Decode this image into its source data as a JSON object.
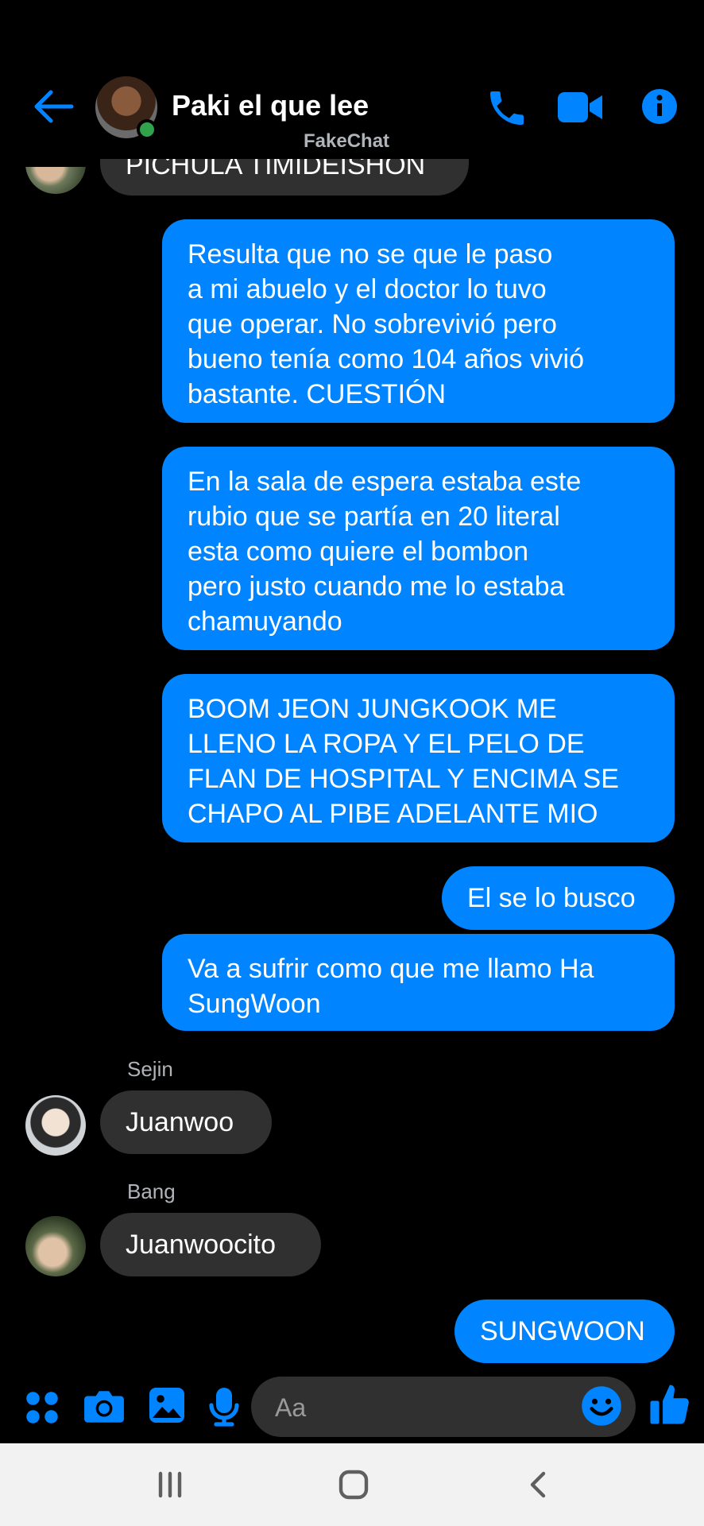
{
  "header": {
    "contact_name": "Paki el que lee",
    "watermark": "FakeChat",
    "icons": [
      "back-arrow-icon",
      "phone-icon",
      "video-camera-icon",
      "info-icon"
    ]
  },
  "messages": {
    "partial_in": "PICHULA TIMIDEISHON",
    "out_1": "Resulta que no se que le paso\na mi abuelo y el doctor lo tuvo\nque operar. No sobrevivió pero\nbueno tenía como 104 años vivió\nbastante. CUESTIÓN",
    "out_2": "En la sala de espera estaba este\nrubio que se partía en 20 literal\nesta como quiere el bombon\npero justo cuando me lo estaba\nchamuyando",
    "out_3": "BOOM JEON JUNGKOOK ME\nLLENO LA ROPA Y EL PELO DE\nFLAN DE HOSPITAL Y ENCIMA SE\nCHAPO AL PIBE ADELANTE MIO",
    "out_4": "El se lo busco",
    "out_5": "Va a sufrir como que me llamo Ha\nSungWoon",
    "sender_1": "Sejin",
    "in_1": "Juanwoo",
    "sender_2": "Bang",
    "in_2": "Juanwoocito",
    "out_6": "SUNGWOON"
  },
  "composer": {
    "placeholder": "Aa",
    "icons": [
      "apps-icon",
      "camera-icon",
      "gallery-icon",
      "microphone-icon",
      "emoji-icon",
      "thumbs-up-icon"
    ]
  },
  "colors": {
    "accent": "#0084ff",
    "incoming_bubble": "#303030",
    "background": "#000000",
    "online": "#31a24c"
  }
}
